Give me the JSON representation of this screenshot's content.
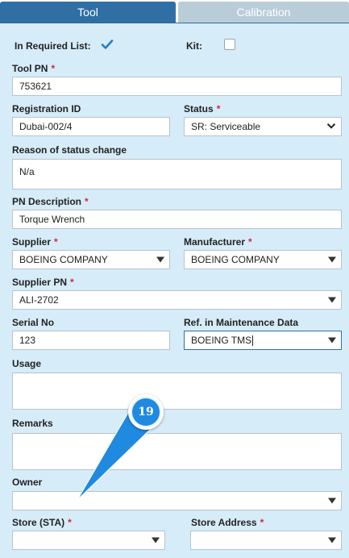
{
  "tabs": {
    "tool": "Tool",
    "calibration": "Calibration"
  },
  "form": {
    "in_required_list": {
      "label": "In Required List:",
      "checked": true
    },
    "kit": {
      "label": "Kit:",
      "checked": false
    },
    "tool_pn": {
      "label": "Tool PN",
      "required_mark": "*",
      "value": "753621"
    },
    "registration_id": {
      "label": "Registration ID",
      "value": "Dubai-002/4"
    },
    "status": {
      "label": "Status",
      "required_mark": "*",
      "value": "SR: Serviceable"
    },
    "reason": {
      "label": "Reason of status change",
      "value": "N/a"
    },
    "pn_description": {
      "label": "PN Description",
      "required_mark": "*",
      "value": "Torque Wrench"
    },
    "supplier": {
      "label": "Supplier",
      "required_mark": "*",
      "value": "BOEING COMPANY"
    },
    "manufacturer": {
      "label": "Manufacturer",
      "required_mark": "*",
      "value": "BOEING COMPANY"
    },
    "supplier_pn": {
      "label": "Supplier PN",
      "required_mark": "*",
      "value": "ALI-2702"
    },
    "serial_no": {
      "label": "Serial No",
      "value": "123"
    },
    "ref_maintenance": {
      "label": "Ref. in Maintenance Data",
      "value": "BOEING TMS"
    },
    "usage": {
      "label": "Usage",
      "value": ""
    },
    "remarks": {
      "label": "Remarks",
      "value": ""
    },
    "owner": {
      "label": "Owner",
      "value": ""
    },
    "store_sta": {
      "label": "Store (STA)",
      "required_mark": "*",
      "value": ""
    },
    "store_address": {
      "label": "Store Address",
      "required_mark": "*",
      "value": ""
    }
  },
  "callout": {
    "number": "19"
  },
  "colors": {
    "tab_active": "#2f6fa3",
    "tab_inactive": "#b9cdd8",
    "panel_bg": "#d6ecf9",
    "required": "#d9262a",
    "callout": "#1f8ae0"
  }
}
